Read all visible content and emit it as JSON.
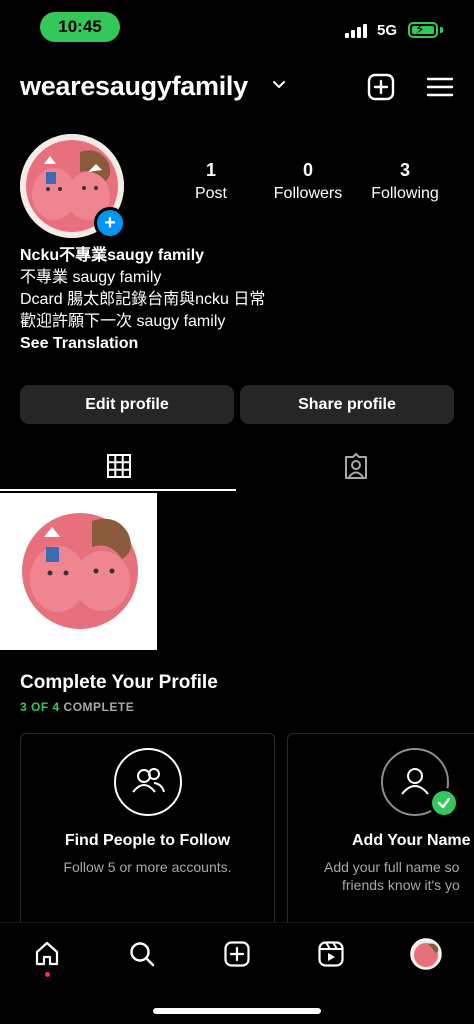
{
  "status_bar": {
    "time": "10:45",
    "network": "5G",
    "accent": "#34c759"
  },
  "header": {
    "username": "wearesaugyfamily",
    "icons": [
      "chevron-down-icon",
      "create-plus-icon",
      "menu-icon"
    ]
  },
  "profile": {
    "stats": [
      {
        "value": "1",
        "label": "Post"
      },
      {
        "value": "0",
        "label": "Followers"
      },
      {
        "value": "3",
        "label": "Following"
      }
    ],
    "bio": {
      "name": "Ncku不專業saugy family",
      "lines": [
        "不專業 saugy family",
        "Dcard 腸太郎記錄台南與ncku 日常",
        "歡迎許願下一次 saugy family"
      ],
      "see_translation": "See Translation"
    },
    "buttons": {
      "edit": "Edit profile",
      "share": "Share profile"
    }
  },
  "tabs": [
    {
      "icon": "grid-icon"
    },
    {
      "icon": "tagged-person-icon"
    }
  ],
  "complete_profile": {
    "title": "Complete Your Profile",
    "progress_text": "3 OF 4",
    "progress_suffix": "COMPLETE",
    "progress": 0.75,
    "cards": [
      {
        "title": "Find People to Follow",
        "desc": "Follow 5 or more accounts.",
        "icon": "people-icon"
      },
      {
        "title": "Add Your Name",
        "desc_line1": "Add your full name so",
        "desc_line2": "friends know it's yo",
        "icon": "person-icon",
        "done": true
      }
    ]
  },
  "bottom_nav": [
    "home-icon",
    "search-icon",
    "create-icon",
    "reels-icon",
    "profile-avatar"
  ],
  "colors": {
    "background": "#000000",
    "button": "#262626",
    "blue": "#0095f6",
    "green": "#34c759",
    "notification": "#ff3040"
  }
}
